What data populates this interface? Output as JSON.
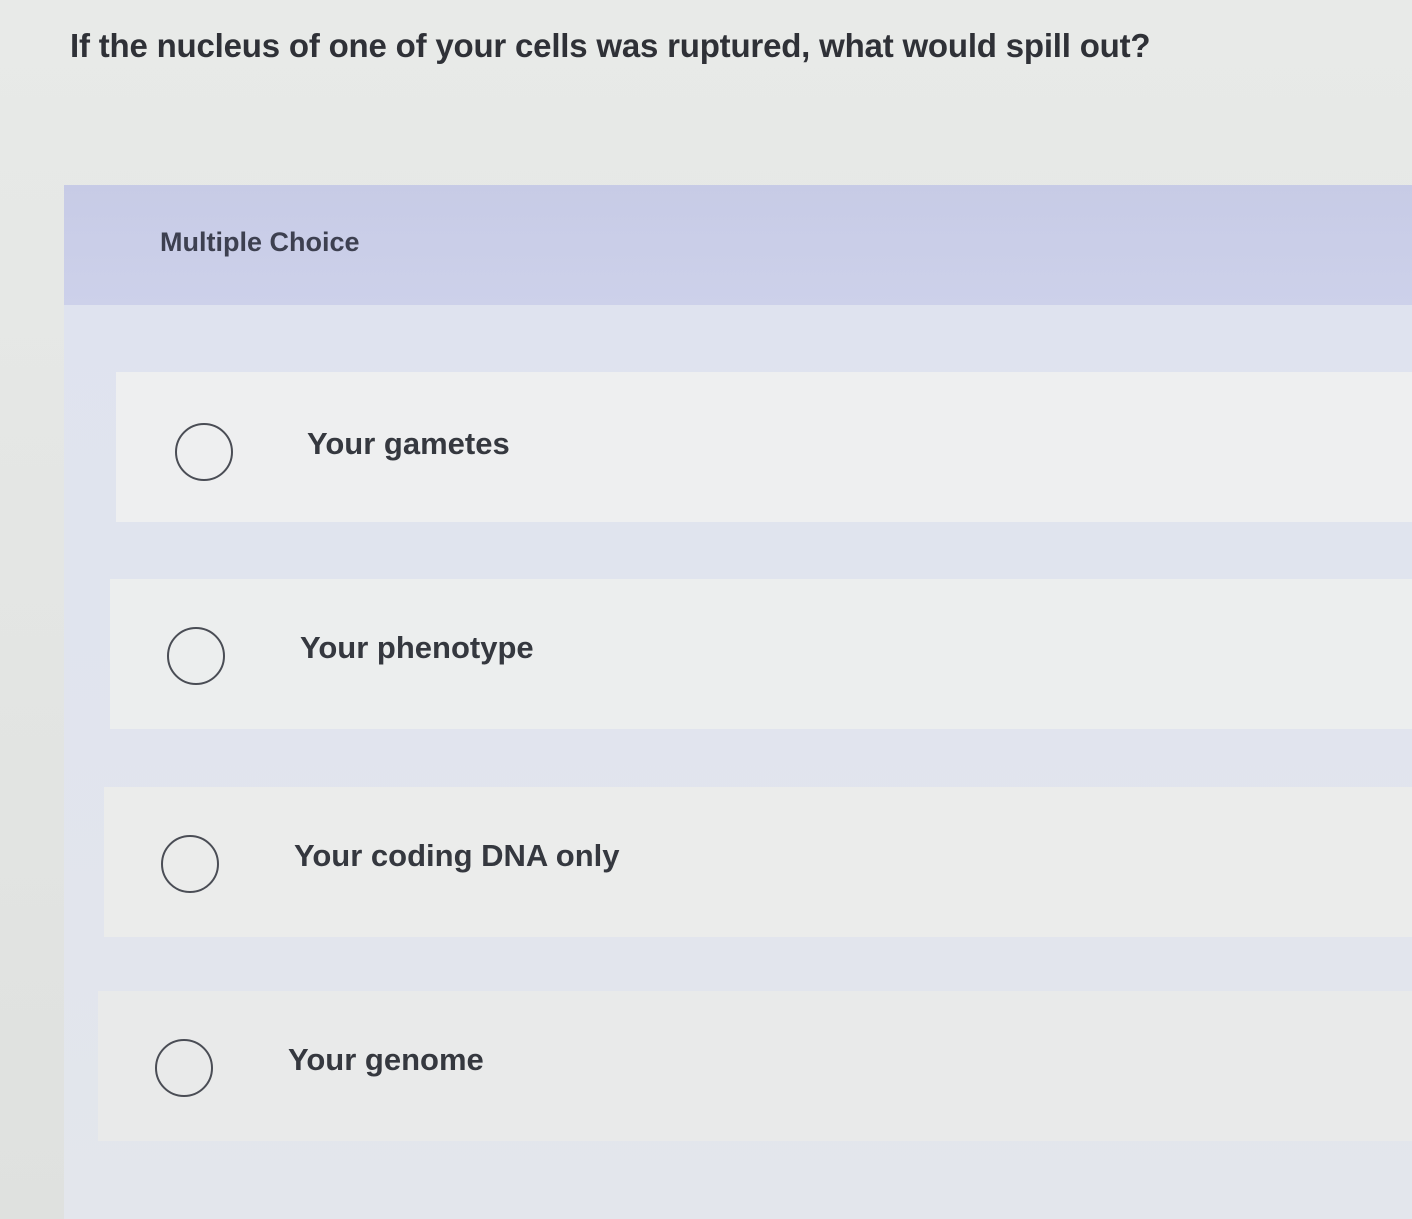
{
  "question": {
    "text": "If the nucleus of one of your cells was ruptured, what would spill out?"
  },
  "multiple_choice": {
    "title": "Multiple Choice",
    "options": [
      {
        "label": "Your gametes",
        "selected": false
      },
      {
        "label": "Your phenotype",
        "selected": false
      },
      {
        "label": "Your coding DNA only",
        "selected": false
      },
      {
        "label": "Your genome",
        "selected": false
      }
    ]
  },
  "colors": {
    "header_band": "#c9cde8",
    "option_background": "#eeeff0",
    "text": "#2f3137",
    "radio_border": "#4a4d55"
  }
}
